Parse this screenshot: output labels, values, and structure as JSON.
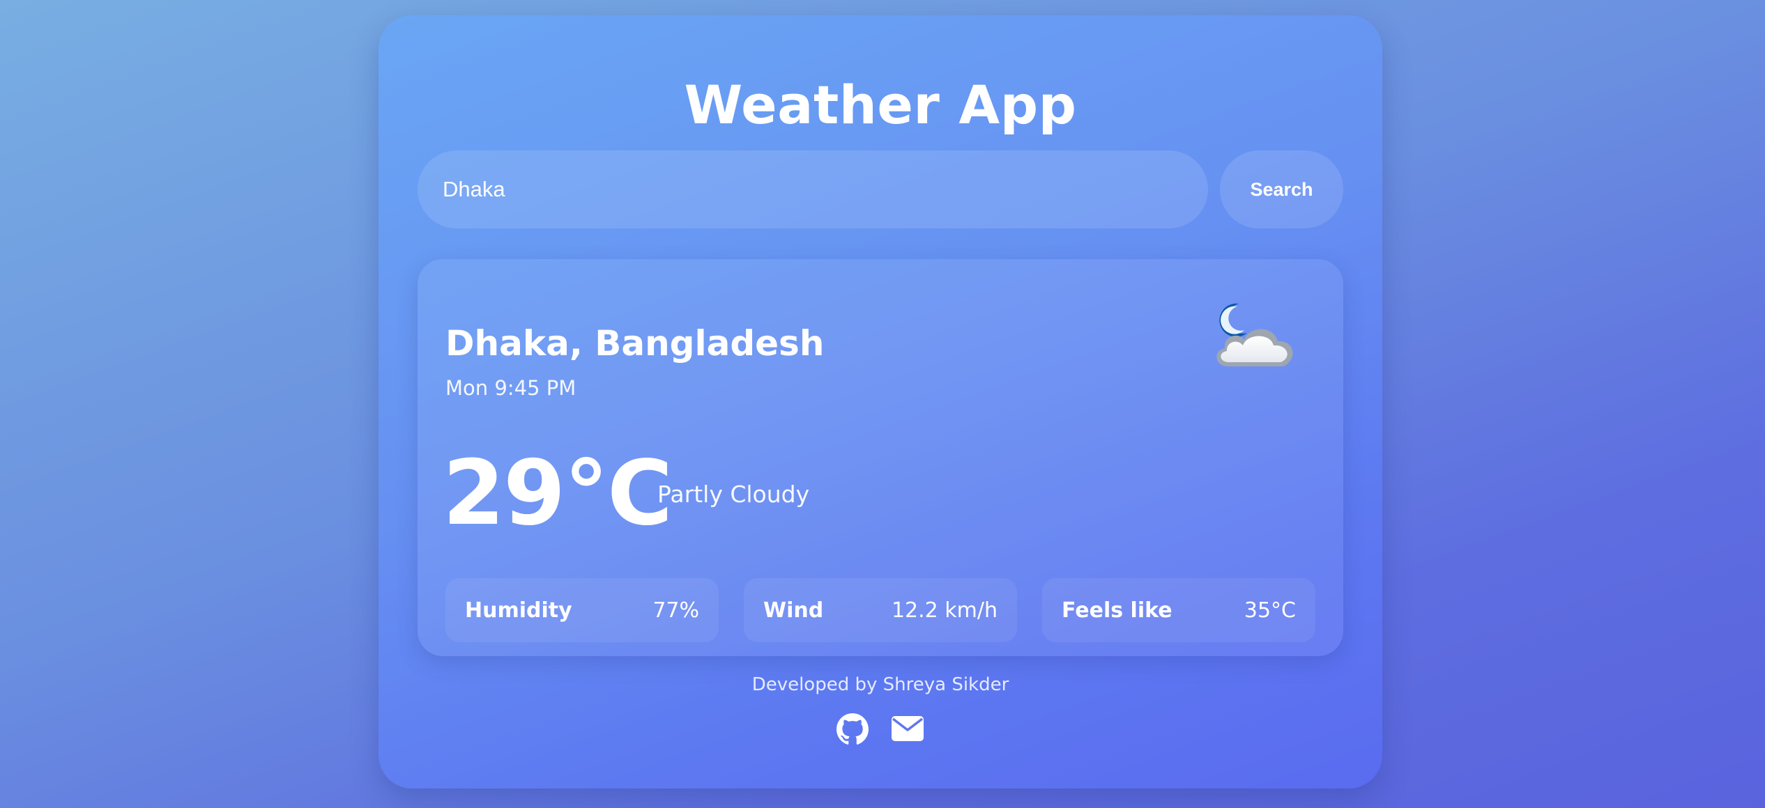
{
  "app": {
    "title": "Weather App"
  },
  "search": {
    "value": "Dhaka",
    "button_label": "Search"
  },
  "weather": {
    "location": "Dhaka, Bangladesh",
    "datetime": "Mon 9:45 PM",
    "temperature": "29°C",
    "condition": "Partly Cloudy",
    "icon": "partly-cloudy-night-icon",
    "stats": [
      {
        "label": "Humidity",
        "value": "77%"
      },
      {
        "label": "Wind",
        "value": "12.2 km/h"
      },
      {
        "label": "Feels like",
        "value": "35°C"
      }
    ]
  },
  "footer": {
    "credit": "Developed by Shreya Sikder",
    "icons": [
      "github-icon",
      "email-icon"
    ]
  },
  "colors": {
    "background_start": "#78aee2",
    "background_end": "#5963dd",
    "card_start": "#6aa6f4",
    "card_end": "#5a6bf0",
    "text": "#ffffff"
  }
}
